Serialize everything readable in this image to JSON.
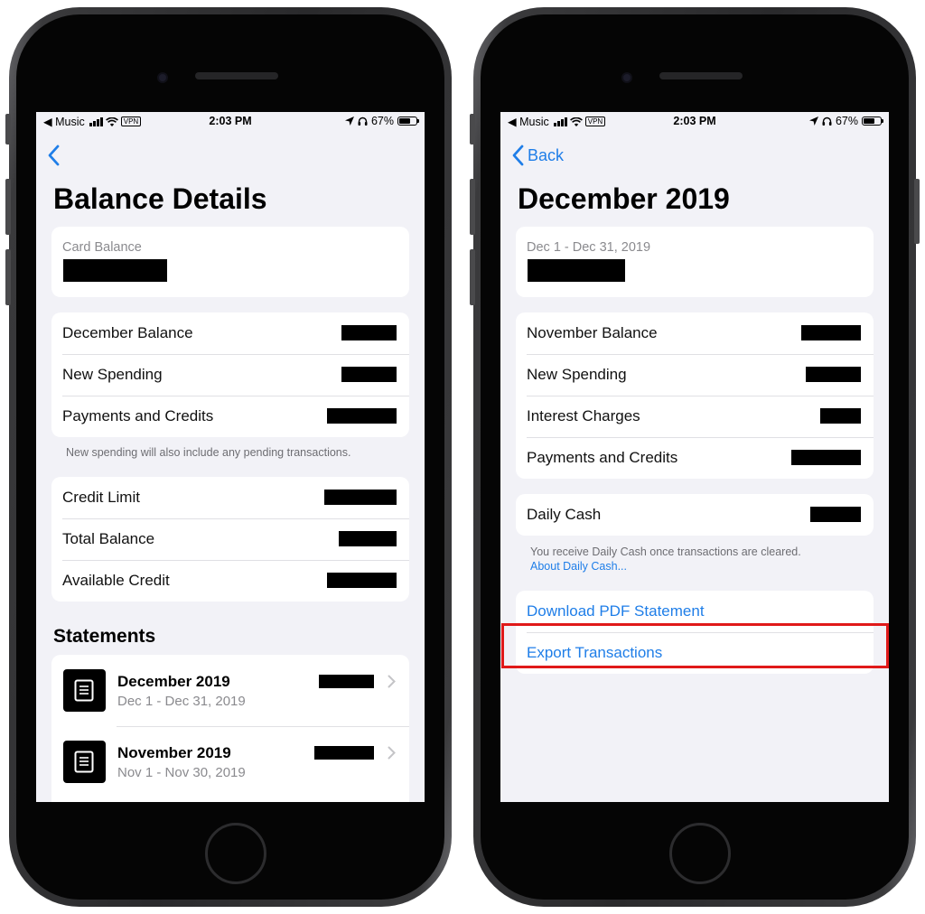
{
  "status": {
    "carrier": "◀ Music",
    "vpn": "VPN",
    "time": "2:03 PM",
    "battery_pct": "67%"
  },
  "left": {
    "back_label": "",
    "title": "Balance Details",
    "card_balance_label": "Card Balance",
    "balance_rows": [
      {
        "label": "December Balance"
      },
      {
        "label": "New Spending"
      },
      {
        "label": "Payments and Credits"
      }
    ],
    "balance_note": "New spending will also include any pending transactions.",
    "credit_rows": [
      {
        "label": "Credit Limit"
      },
      {
        "label": "Total Balance"
      },
      {
        "label": "Available Credit"
      }
    ],
    "statements_heading": "Statements",
    "statements": [
      {
        "name": "December 2019",
        "range": "Dec 1 - Dec 31, 2019"
      },
      {
        "name": "November 2019",
        "range": "Nov 1 - Nov 30, 2019"
      }
    ]
  },
  "right": {
    "back_label": "Back",
    "title": "December 2019",
    "period_label": "Dec 1 - Dec 31, 2019",
    "balance_rows": [
      {
        "label": "November Balance"
      },
      {
        "label": "New Spending"
      },
      {
        "label": "Interest Charges"
      },
      {
        "label": "Payments and Credits"
      }
    ],
    "daily_cash_label": "Daily Cash",
    "daily_cash_note": "You receive Daily Cash once transactions are cleared.",
    "daily_cash_link": "About Daily Cash...",
    "actions": {
      "download_pdf": "Download PDF Statement",
      "export_transactions": "Export Transactions"
    }
  },
  "colors": {
    "accent": "#1f7ee8",
    "highlight": "#e01919",
    "background": "#f2f2f7"
  },
  "icons": [
    "chevron-left-icon",
    "chevron-right-icon",
    "document-icon",
    "wifi-icon",
    "location-arrow-icon",
    "headphones-icon",
    "battery-icon",
    "signal-icon"
  ]
}
